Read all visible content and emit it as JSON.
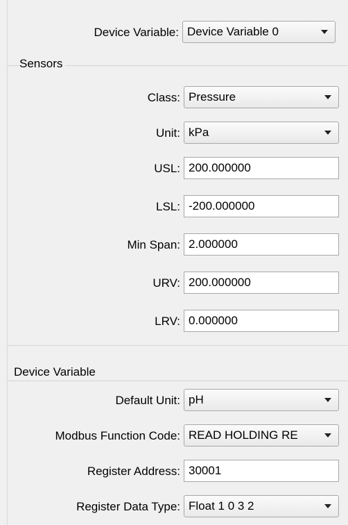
{
  "device_variable_select": {
    "label": "Device Variable:",
    "value": "Device Variable 0"
  },
  "sensors": {
    "title": "Sensors",
    "class": {
      "label": "Class:",
      "value": "Pressure"
    },
    "unit": {
      "label": "Unit:",
      "value": "kPa"
    },
    "usl": {
      "label": "USL:",
      "value": "200.000000"
    },
    "lsl": {
      "label": "LSL:",
      "value": "-200.000000"
    },
    "min_span": {
      "label": "Min Span:",
      "value": "2.000000"
    },
    "urv": {
      "label": "URV:",
      "value": "200.000000"
    },
    "lrv": {
      "label": "LRV:",
      "value": "0.000000"
    }
  },
  "device_variable_group": {
    "title": "Device  Variable",
    "default_unit": {
      "label": "Default Unit:",
      "value": "pH"
    },
    "modbus_function_code": {
      "label": "Modbus Function Code:",
      "value": "READ HOLDING RE"
    },
    "register_address": {
      "label": "Register Address:",
      "value": "30001"
    },
    "register_data_type": {
      "label": "Register Data Type:",
      "value": "Float 1 0 3 2"
    }
  }
}
